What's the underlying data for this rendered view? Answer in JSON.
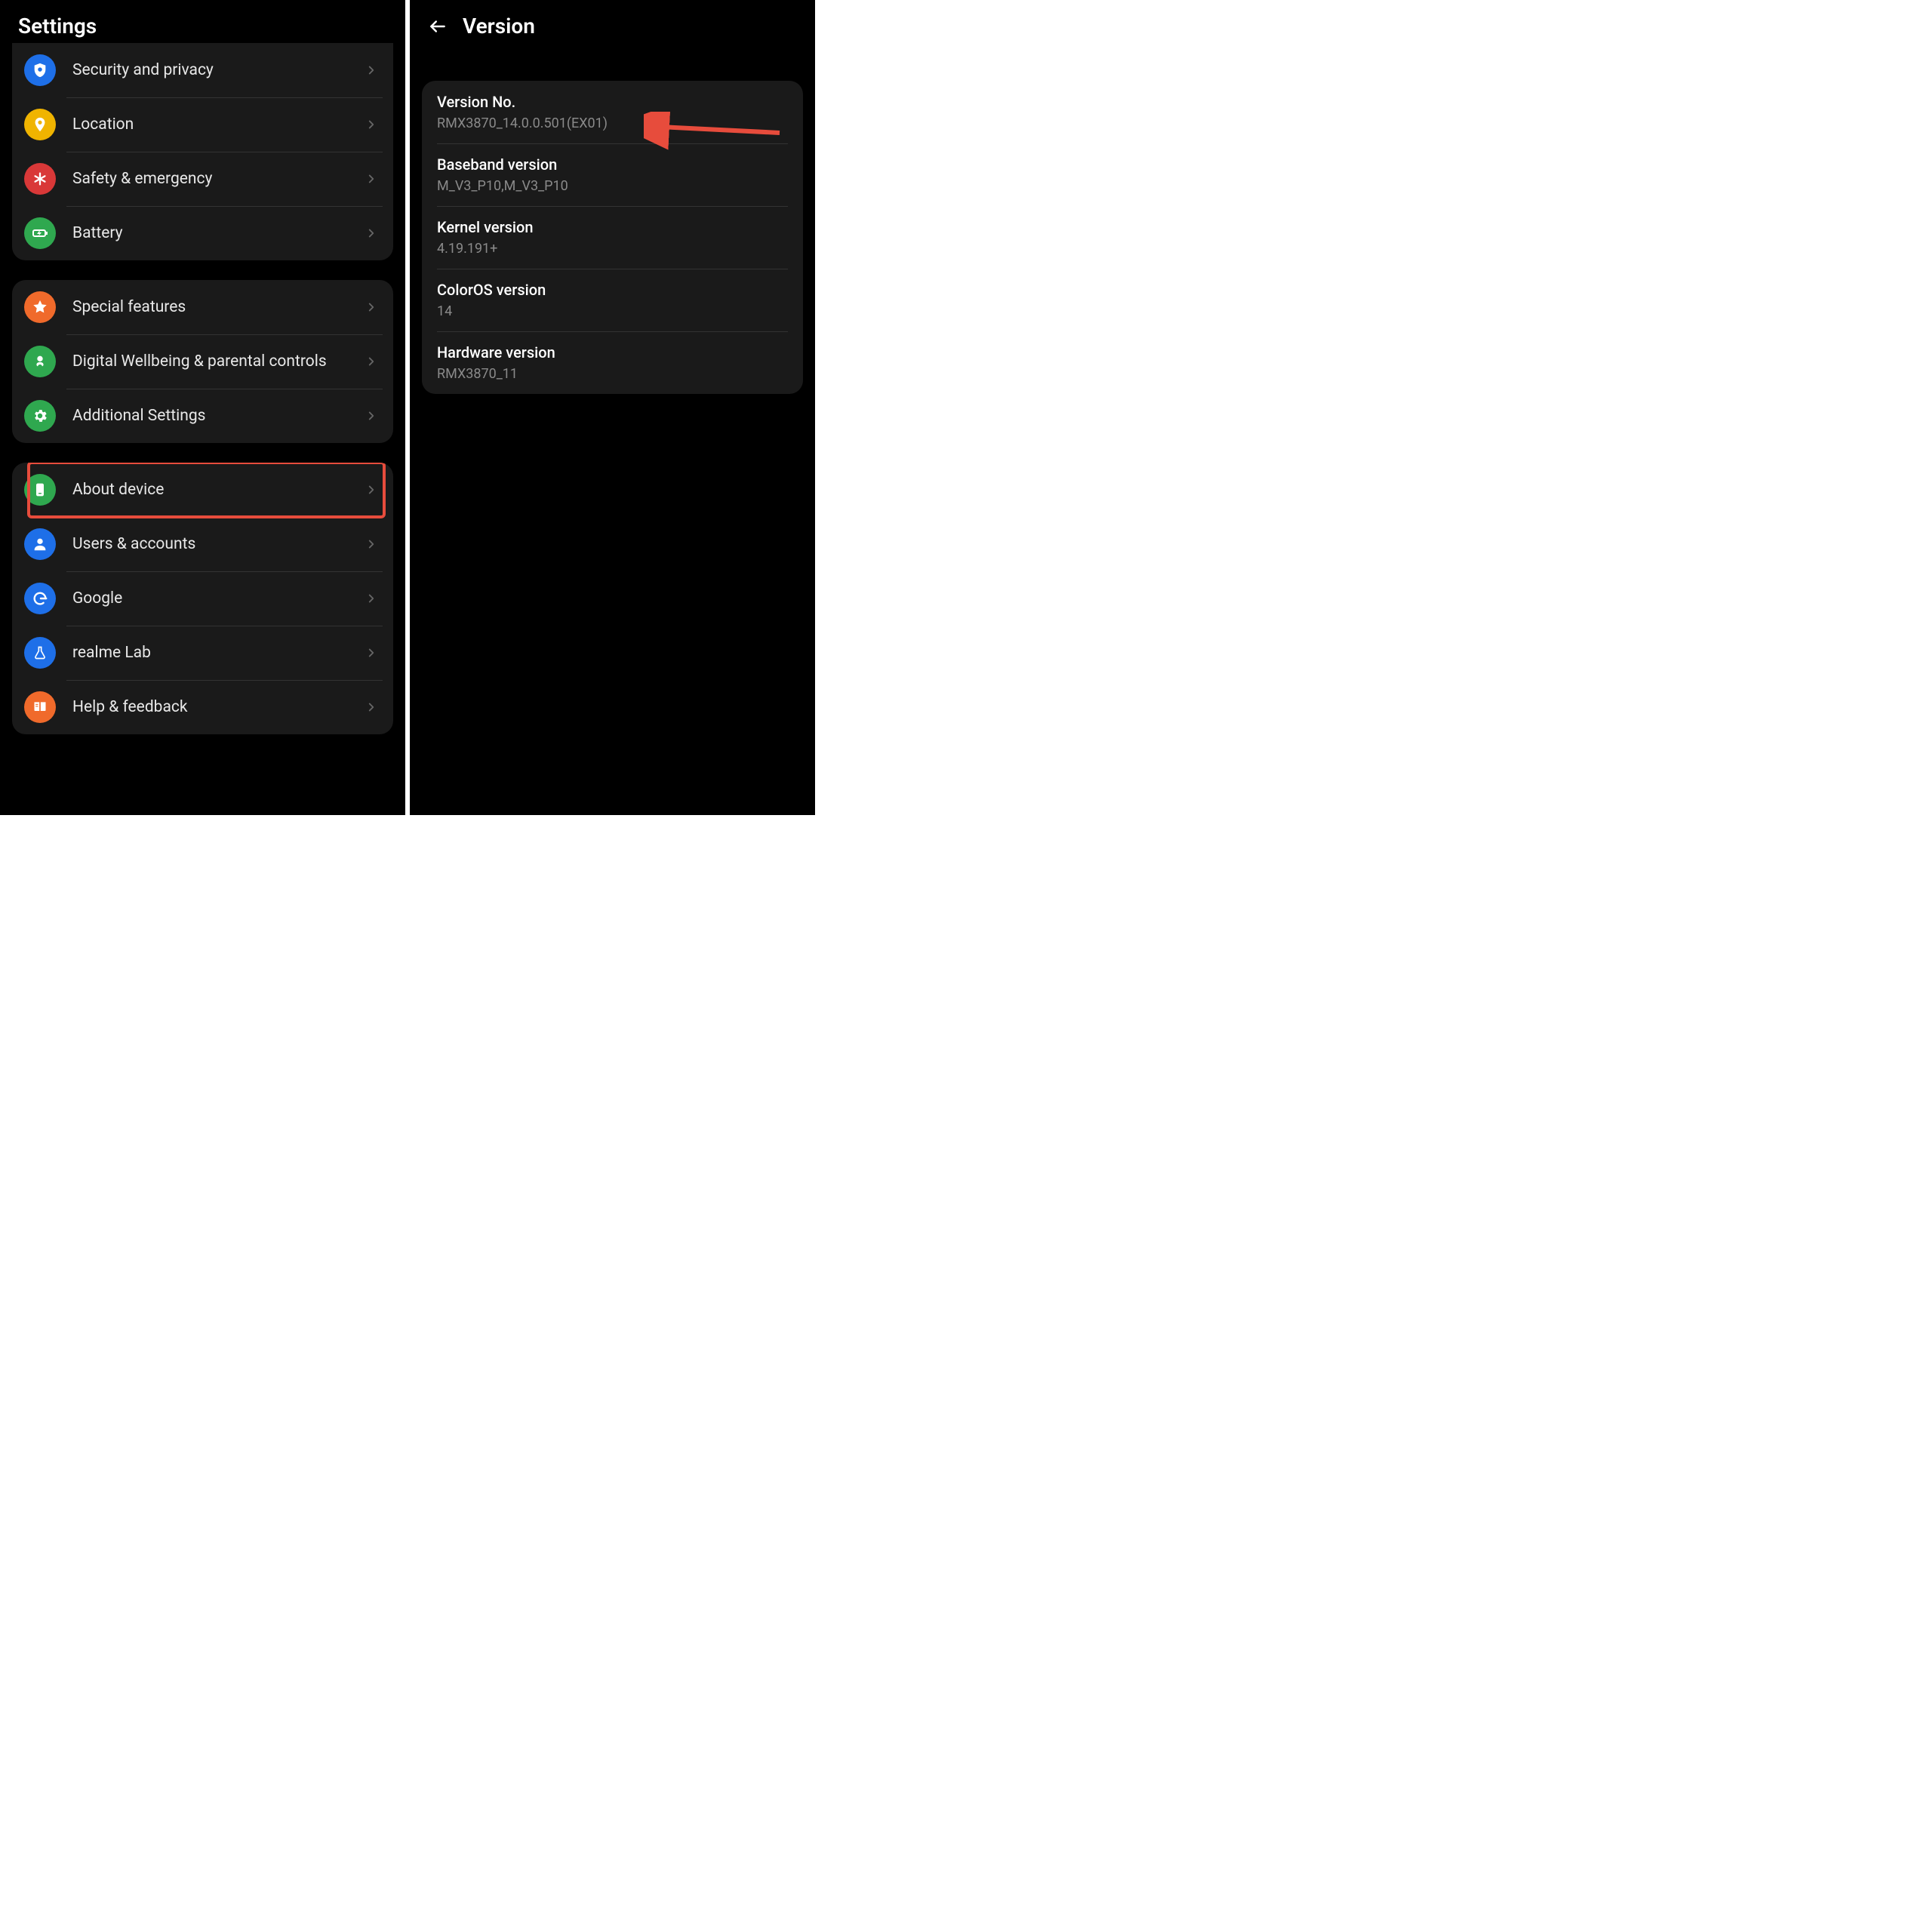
{
  "left": {
    "title": "Settings",
    "groups": [
      {
        "items": [
          {
            "id": "security",
            "label": "Security and privacy",
            "icon": "shield",
            "bg": "#1E6FE8"
          },
          {
            "id": "location",
            "label": "Location",
            "icon": "pin",
            "bg": "#F0B400"
          },
          {
            "id": "safety",
            "label": "Safety & emergency",
            "icon": "asterisk",
            "bg": "#D93838"
          },
          {
            "id": "battery",
            "label": "Battery",
            "icon": "battery",
            "bg": "#2FA84F"
          }
        ]
      },
      {
        "items": [
          {
            "id": "special",
            "label": "Special features",
            "icon": "star",
            "bg": "#F06A2B"
          },
          {
            "id": "wellbeing",
            "label": "Digital Wellbeing & parental controls",
            "icon": "heart-person",
            "bg": "#2FA84F"
          },
          {
            "id": "additional",
            "label": "Additional Settings",
            "icon": "gear",
            "bg": "#2FA84F"
          }
        ]
      },
      {
        "items": [
          {
            "id": "about",
            "label": "About device",
            "icon": "device",
            "bg": "#2FA84F",
            "highlight": true
          },
          {
            "id": "users",
            "label": "Users & accounts",
            "icon": "person",
            "bg": "#1E6FE8"
          },
          {
            "id": "google",
            "label": "Google",
            "icon": "google",
            "bg": "#1E6FE8"
          },
          {
            "id": "realme-lab",
            "label": "realme Lab",
            "icon": "flask",
            "bg": "#1E6FE8"
          },
          {
            "id": "help",
            "label": "Help & feedback",
            "icon": "book",
            "bg": "#F06A2B"
          }
        ]
      }
    ]
  },
  "right": {
    "title": "Version",
    "rows": [
      {
        "label": "Version No.",
        "value": "RMX3870_14.0.0.501(EX01)",
        "arrow": true
      },
      {
        "label": "Baseband version",
        "value": "M_V3_P10,M_V3_P10"
      },
      {
        "label": "Kernel version",
        "value": "4.19.191+"
      },
      {
        "label": "ColorOS version",
        "value": "14"
      },
      {
        "label": "Hardware version",
        "value": "RMX3870_11"
      }
    ]
  }
}
